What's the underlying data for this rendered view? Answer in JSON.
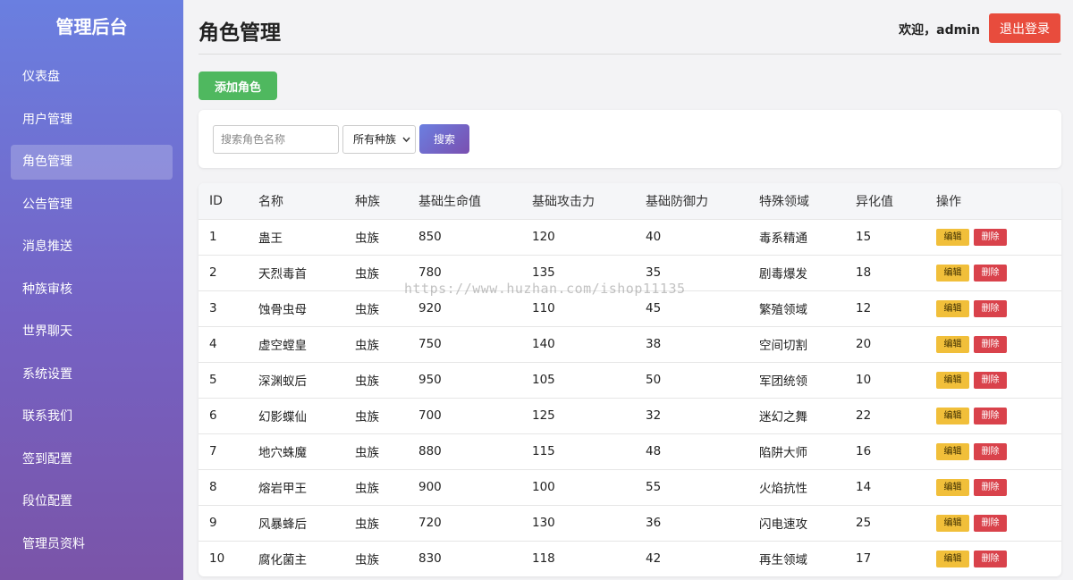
{
  "sidebar": {
    "brand": "管理后台",
    "items": [
      {
        "label": "仪表盘",
        "active": false
      },
      {
        "label": "用户管理",
        "active": false
      },
      {
        "label": "角色管理",
        "active": true
      },
      {
        "label": "公告管理",
        "active": false
      },
      {
        "label": "消息推送",
        "active": false
      },
      {
        "label": "种族审核",
        "active": false
      },
      {
        "label": "世界聊天",
        "active": false
      },
      {
        "label": "系统设置",
        "active": false
      },
      {
        "label": "联系我们",
        "active": false
      },
      {
        "label": "签到配置",
        "active": false
      },
      {
        "label": "段位配置",
        "active": false
      },
      {
        "label": "管理员资料",
        "active": false
      }
    ]
  },
  "header": {
    "title": "角色管理",
    "welcome": "欢迎，admin",
    "logout_label": "退出登录"
  },
  "toolbar": {
    "add_label": "添加角色"
  },
  "search": {
    "placeholder": "搜索角色名称",
    "race_selected": "所有种族",
    "button_label": "搜索"
  },
  "table": {
    "headers": [
      "ID",
      "名称",
      "种族",
      "基础生命值",
      "基础攻击力",
      "基础防御力",
      "特殊领域",
      "异化值",
      "操作"
    ],
    "edit_label": "编辑",
    "delete_label": "删除",
    "rows": [
      {
        "id": "1",
        "name": "蛊王",
        "race": "虫族",
        "hp": "850",
        "atk": "120",
        "def": "40",
        "field": "毒系精通",
        "alien": "15"
      },
      {
        "id": "2",
        "name": "天烈毒首",
        "race": "虫族",
        "hp": "780",
        "atk": "135",
        "def": "35",
        "field": "剧毒爆发",
        "alien": "18"
      },
      {
        "id": "3",
        "name": "蚀骨虫母",
        "race": "虫族",
        "hp": "920",
        "atk": "110",
        "def": "45",
        "field": "繁殖领域",
        "alien": "12"
      },
      {
        "id": "4",
        "name": "虚空螳皇",
        "race": "虫族",
        "hp": "750",
        "atk": "140",
        "def": "38",
        "field": "空间切割",
        "alien": "20"
      },
      {
        "id": "5",
        "name": "深渊蚁后",
        "race": "虫族",
        "hp": "950",
        "atk": "105",
        "def": "50",
        "field": "军团统领",
        "alien": "10"
      },
      {
        "id": "6",
        "name": "幻影蝶仙",
        "race": "虫族",
        "hp": "700",
        "atk": "125",
        "def": "32",
        "field": "迷幻之舞",
        "alien": "22"
      },
      {
        "id": "7",
        "name": "地穴蛛魔",
        "race": "虫族",
        "hp": "880",
        "atk": "115",
        "def": "48",
        "field": "陷阱大师",
        "alien": "16"
      },
      {
        "id": "8",
        "name": "熔岩甲王",
        "race": "虫族",
        "hp": "900",
        "atk": "100",
        "def": "55",
        "field": "火焰抗性",
        "alien": "14"
      },
      {
        "id": "9",
        "name": "风暴蜂后",
        "race": "虫族",
        "hp": "720",
        "atk": "130",
        "def": "36",
        "field": "闪电速攻",
        "alien": "25"
      },
      {
        "id": "10",
        "name": "腐化菌主",
        "race": "虫族",
        "hp": "830",
        "atk": "118",
        "def": "42",
        "field": "再生领域",
        "alien": "17"
      }
    ]
  },
  "watermark": "https://www.huzhan.com/ishop11135"
}
